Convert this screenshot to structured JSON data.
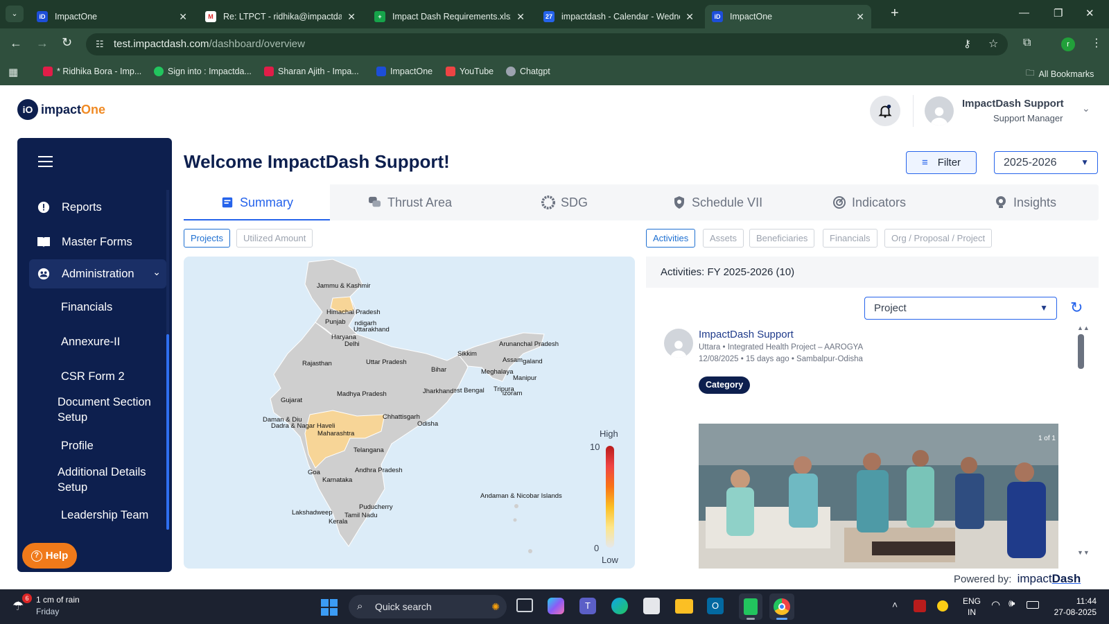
{
  "browser": {
    "tabs": [
      {
        "title": "ImpactOne",
        "fav": "iD",
        "color": "#1d4ed8"
      },
      {
        "title": "Re: LTPCT - ridhika@impactdas",
        "fav": "M",
        "color": "#dc2626"
      },
      {
        "title": "Impact Dash Requirements.xlsx",
        "fav": "+",
        "color": "#16a34a"
      },
      {
        "title": "impactdash - Calendar - Wedne",
        "fav": "27",
        "color": "#2563eb"
      },
      {
        "title": "ImpactOne",
        "fav": "iD",
        "color": "#1d4ed8"
      }
    ],
    "url_host": "test.impactdash.com",
    "url_path": "/dashboard/overview",
    "profile_initial": "r",
    "bookmarks": [
      {
        "label": "* Ridhika Bora - Imp...",
        "color": "#e11d48"
      },
      {
        "label": "Sign into : Impactda...",
        "color": "#22c55e"
      },
      {
        "label": "Sharan Ajith - Impa...",
        "color": "#e11d48"
      },
      {
        "label": "ImpactOne",
        "color": "#1d4ed8"
      },
      {
        "label": "YouTube",
        "color": "#ef4444"
      },
      {
        "label": "Chatgpt",
        "color": "#9ca3af"
      }
    ],
    "all_bookmarks": "All Bookmarks"
  },
  "header": {
    "logo_prefix": "impact",
    "logo_suffix": "One",
    "logo_badge": "iO",
    "user_name": "ImpactDash Support",
    "user_role": "Support Manager"
  },
  "sidebar": {
    "items": [
      {
        "label": "Reports"
      },
      {
        "label": "Master Forms"
      },
      {
        "label": "Administration"
      }
    ],
    "subitems": [
      "Financials",
      "Annexure-II",
      "CSR Form 2",
      "Document Section Setup",
      "Profile",
      "Additional Details Setup",
      "Leadership Team"
    ],
    "help": "Help"
  },
  "main": {
    "welcome": "Welcome ImpactDash Support!",
    "filter_label": "Filter",
    "year": "2025-2026",
    "tabs": [
      "Summary",
      "Thrust Area",
      "SDG",
      "Schedule VII",
      "Indicators",
      "Insights"
    ],
    "left_pills": [
      "Projects",
      "Utilized Amount"
    ],
    "right_pills": [
      "Activities",
      "Assets",
      "Beneficiaries",
      "Financials",
      "Org / Proposal / Project"
    ],
    "legend_high": "High",
    "legend_low": "Low",
    "legend_max": "10",
    "legend_min": "0"
  },
  "map": {
    "labels": [
      "Jammu & Kashmir",
      "Himachal Pradesh",
      "Punjab",
      "Chandigarh",
      "Uttarakhand",
      "Haryana",
      "Delhi",
      "Rajasthan",
      "Uttar Pradesh",
      "Sikkim",
      "Arunanchal Pradesh",
      "Assam",
      "Nagaland",
      "Meghalaya",
      "Manipur",
      "Bihar",
      "Jharkhand",
      "West Bengal",
      "Tripura",
      "Mizoram",
      "Madhya Pradesh",
      "Gujarat",
      "Chhattisgarh",
      "Odisha",
      "Daman & Diu",
      "Dadra & Nagar Haveli",
      "Maharashtra",
      "Telangana",
      "Andhra Pradesh",
      "Goa",
      "Karnataka",
      "Andaman & Nicobar Islands",
      "Puducherry",
      "Lakshadweep",
      "Tamil Nadu",
      "Kerala"
    ]
  },
  "activities": {
    "title": "Activities: FY 2025-2026 (10)",
    "project_select": "Project",
    "author": "ImpactDash Support",
    "org_line": "Uttara • Integrated Health Project – AAROGYA",
    "meta_line": "12/08/2025 • 15 days ago • Sambalpur-Odisha",
    "category": "Category",
    "image_counter": "1 of 1"
  },
  "footer": {
    "powered_by": "Powered by:",
    "brand_a": "impact",
    "brand_b": "Dash"
  },
  "taskbar": {
    "weather_temp": "1 cm of rain",
    "weather_day": "Friday",
    "weather_badge": "6",
    "search": "Quick search",
    "lang1": "ENG",
    "lang2": "IN",
    "time": "11:44",
    "date": "27-08-2025"
  }
}
